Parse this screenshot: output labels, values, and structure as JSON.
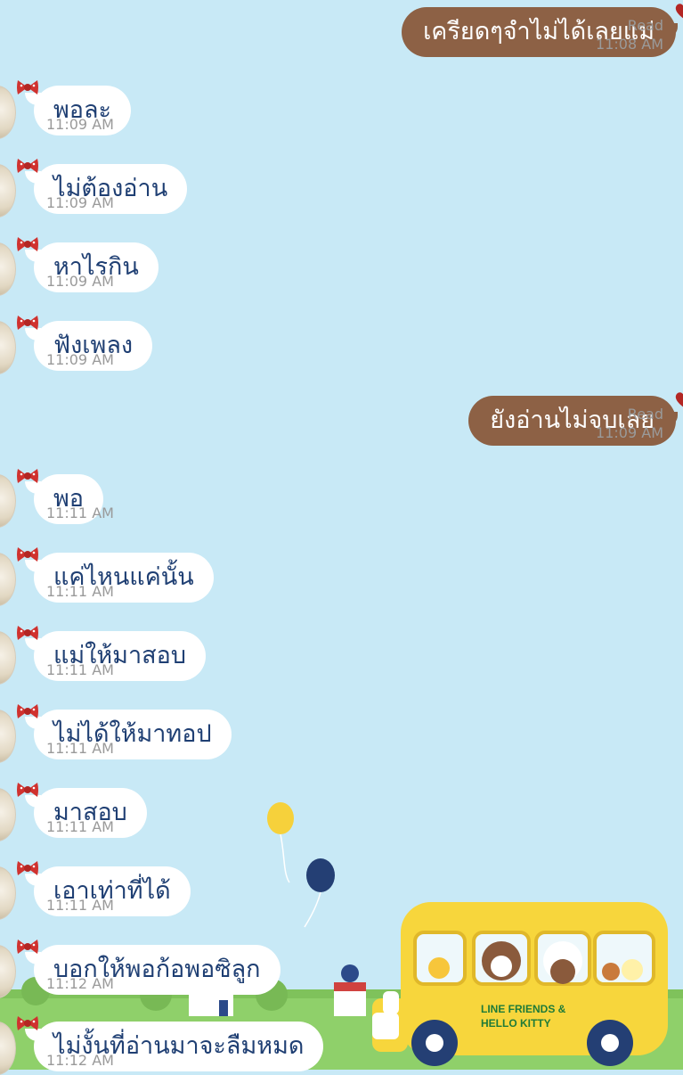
{
  "messages": [
    {
      "dir": "out",
      "text": "เครียดๆจำไม่ได้เลยแม่",
      "read": "Read",
      "time": "11:08 AM"
    },
    {
      "dir": "in",
      "text": "พอละ",
      "time": "11:09 AM"
    },
    {
      "dir": "in",
      "text": "ไม่ต้องอ่าน",
      "time": "11:09 AM"
    },
    {
      "dir": "in",
      "text": "หาไรกิน",
      "time": "11:09 AM"
    },
    {
      "dir": "in",
      "text": "ฟังเพลง",
      "time": "11:09 AM"
    },
    {
      "dir": "out",
      "text": "ยังอ่านไม่จบเลย",
      "read": "Read",
      "time": "11:09 AM"
    },
    {
      "dir": "in",
      "text": "พอ",
      "time": "11:11 AM"
    },
    {
      "dir": "in",
      "text": "แค่ไหนแค่นั้น",
      "time": "11:11 AM"
    },
    {
      "dir": "in",
      "text": "แม่ให้มาสอบ",
      "time": "11:11 AM"
    },
    {
      "dir": "in",
      "text": "ไม่ได้ให้มาทอป",
      "time": "11:11 AM"
    },
    {
      "dir": "in",
      "text": "มาสอบ",
      "time": "11:11 AM"
    },
    {
      "dir": "in",
      "text": "เอาเท่าที่ได้",
      "time": "11:11 AM"
    },
    {
      "dir": "in",
      "text": "บอกให้พอก้อพอซิลูก",
      "time": "11:12 AM"
    },
    {
      "dir": "in",
      "text": "ไม่งั้นที่อ่านมาจะลืมหมด",
      "time": "11:12 AM"
    }
  ],
  "theme": {
    "background": "#c8e9f6",
    "outgoing_bubble": "#8d6145",
    "incoming_bubble": "#ffffff",
    "incoming_text": "#1f3f73",
    "timestamp": "#9a9a9a"
  },
  "decor": {
    "bus_label_line1": "LINE FRIENDS &",
    "bus_label_line2": "HELLO KITTY",
    "icons": [
      "bow-icon",
      "heart-icon",
      "balloon-icon",
      "bus-illustration"
    ]
  }
}
